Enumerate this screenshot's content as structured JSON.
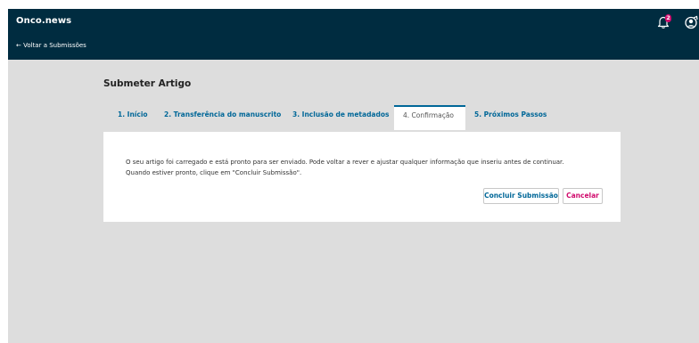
{
  "header": {
    "site_title": "Onco.news",
    "back_link": "← Voltar a Submissões",
    "notifications_count": "2"
  },
  "page": {
    "title": "Submeter Artigo"
  },
  "tabs": [
    {
      "label": "1. Início",
      "active": false
    },
    {
      "label": "2. Transferência do manuscrito",
      "active": false
    },
    {
      "label": "3. Inclusão de metadados",
      "active": false
    },
    {
      "label": "4. Confirmação",
      "active": true
    },
    {
      "label": "5. Próximos Passos",
      "active": false
    }
  ],
  "confirmation": {
    "line1": "O seu artigo foi carregado e está pronto para ser enviado. Pode voltar a rever e ajustar qualquer informação que inseriu antes de continuar.",
    "line2": "Quando estiver pronto, clique em \"Concluir Submissão\".",
    "submit_label": "Concluir Submissão",
    "cancel_label": "Cancelar"
  },
  "colors": {
    "header_bg": "#002c40",
    "link": "#006798",
    "danger": "#d00a6c",
    "page_bg": "#dddddd"
  },
  "icons": [
    "bell-icon",
    "user-icon"
  ]
}
